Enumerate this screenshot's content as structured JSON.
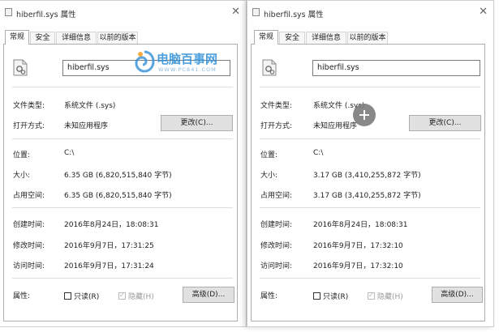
{
  "left": {
    "title": "hiberfil.sys 属性",
    "tabs": [
      "常规",
      "安全",
      "详细信息",
      "以前的版本"
    ],
    "file_name": "hiberfil.sys",
    "type_label": "文件类型:",
    "type_value": "系统文件 (.sys)",
    "open_label": "打开方式:",
    "open_value": "未知应用程序",
    "change_button": "更改(C)...",
    "location_label": "位置:",
    "location_value": "C:\\",
    "size_label": "大小:",
    "size_value": "6.35 GB (6,820,515,840 字节)",
    "disk_label": "占用空间:",
    "disk_value": "6.35 GB (6,820,515,840 字节)",
    "created_label": "创建时间:",
    "created_value": "2016年8月24日，18:08:31",
    "modified_label": "修改时间:",
    "modified_value": "2016年9月7日，17:31:25",
    "accessed_label": "访问时间:",
    "accessed_value": "2016年9月7日，17:31:24",
    "attr_label": "属性:",
    "readonly_label": "只读(R)",
    "hidden_label": "隐藏(H)",
    "advanced_button": "高级(D)..."
  },
  "right": {
    "title": "hiberfil.sys 属性",
    "tabs": [
      "常规",
      "安全",
      "详细信息",
      "以前的版本"
    ],
    "file_name": "hiberfil.sys",
    "type_label": "文件类型:",
    "type_value": "系统文件 (.sys)",
    "open_label": "打开方式:",
    "open_value": "未知应用程序",
    "change_button": "更改(C)...",
    "location_label": "位置:",
    "location_value": "C:\\",
    "size_label": "大小:",
    "size_value": "3.17 GB (3,410,255,872 字节)",
    "disk_label": "占用空间:",
    "disk_value": "3.17 GB (3,410,255,872 字节)",
    "created_label": "创建时间:",
    "created_value": "2016年8月24日，18:08:31",
    "modified_label": "修改时间:",
    "modified_value": "2016年9月7日，17:32:10",
    "accessed_label": "访问时间:",
    "accessed_value": "2016年9月7日，17:32:10",
    "attr_label": "属性:",
    "readonly_label": "只读(R)",
    "hidden_label": "隐藏(H)",
    "advanced_button": "高级(D)..."
  },
  "watermark": {
    "main": "电脑百事网",
    "sub": "WWW.PC841.COM"
  },
  "colors": {
    "border": "#adadad",
    "button_bg": "#e1e1e1",
    "watermark_blue": "#2e8fd8",
    "overlay_plus": "#7c7c7c"
  }
}
